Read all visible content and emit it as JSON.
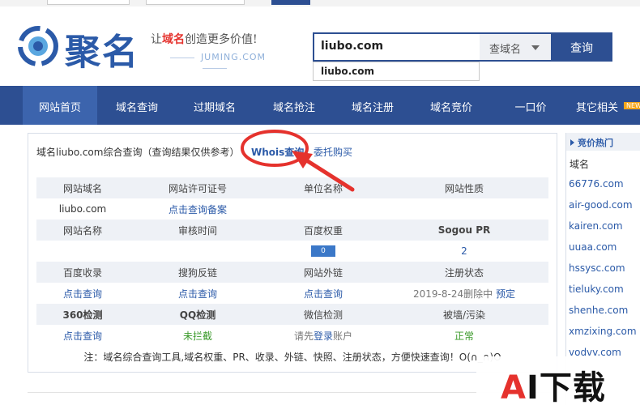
{
  "header": {
    "brand_name": "聚名",
    "slogan_pre": "让",
    "slogan_highlight": "域名",
    "slogan_post": "创造更多价值!",
    "site_domain": "JUMING.COM",
    "search": {
      "value": "liubo.com",
      "select_label": "查域名",
      "button_label": "查询",
      "suggestion": "liubo.com"
    }
  },
  "nav": {
    "items": [
      "网站首页",
      "域名查询",
      "过期域名",
      "域名抢注",
      "域名注册",
      "域名竞价",
      "一口价",
      "其它相关"
    ],
    "new_badge": "NEW"
  },
  "panel": {
    "title": "域名liubo.com综合查询（查询结果仅供参考）",
    "tab_whois": "Whois查询",
    "tab_sep": "|",
    "tab_buy": "委托购买",
    "table": {
      "row1_headers": [
        "网站域名",
        "网站许可证号",
        "单位名称",
        "网站性质"
      ],
      "row1_values": [
        "liubo.com",
        "点击查询备案",
        "",
        ""
      ],
      "row2_headers": [
        "网站名称",
        "审核时间",
        "百度权重",
        "Sogou PR"
      ],
      "row2_values": [
        "",
        "",
        "0",
        "2"
      ],
      "row3_headers": [
        "百度收录",
        "搜狗反链",
        "网站外链",
        "注册状态"
      ],
      "row3_values": [
        "点击查询",
        "点击查询",
        "点击查询",
        "2019-8-24删除中"
      ],
      "row3_extra": "预定",
      "row4_headers": [
        "360检测",
        "QQ检测",
        "微信检测",
        "被墙/污染"
      ],
      "row4_values": [
        "点击查询",
        "未拦截",
        "请先",
        "正常"
      ],
      "row4_login": "登录",
      "row4_login_post": "账户"
    },
    "note": "注：域名综合查询工具,域名权重、PR、收录、外链、快照、注册状态，方便快速查询！O(∩_∩)O"
  },
  "sidebar": {
    "heading": "竞价热门",
    "subheading": "域名",
    "domains": [
      "66776.com",
      "air-good.com",
      "kairen.com",
      "uuaa.com",
      "hssysc.com",
      "tieluky.com",
      "shenhe.com",
      "xmzixing.com",
      "vodvv.com"
    ]
  },
  "watermark": {
    "a": "A",
    "rest": "I下载"
  },
  "colors": {
    "primary": "#2d4f92",
    "link": "#2b5aa8",
    "highlight": "#e5322d",
    "ok": "#3a9a2a"
  }
}
